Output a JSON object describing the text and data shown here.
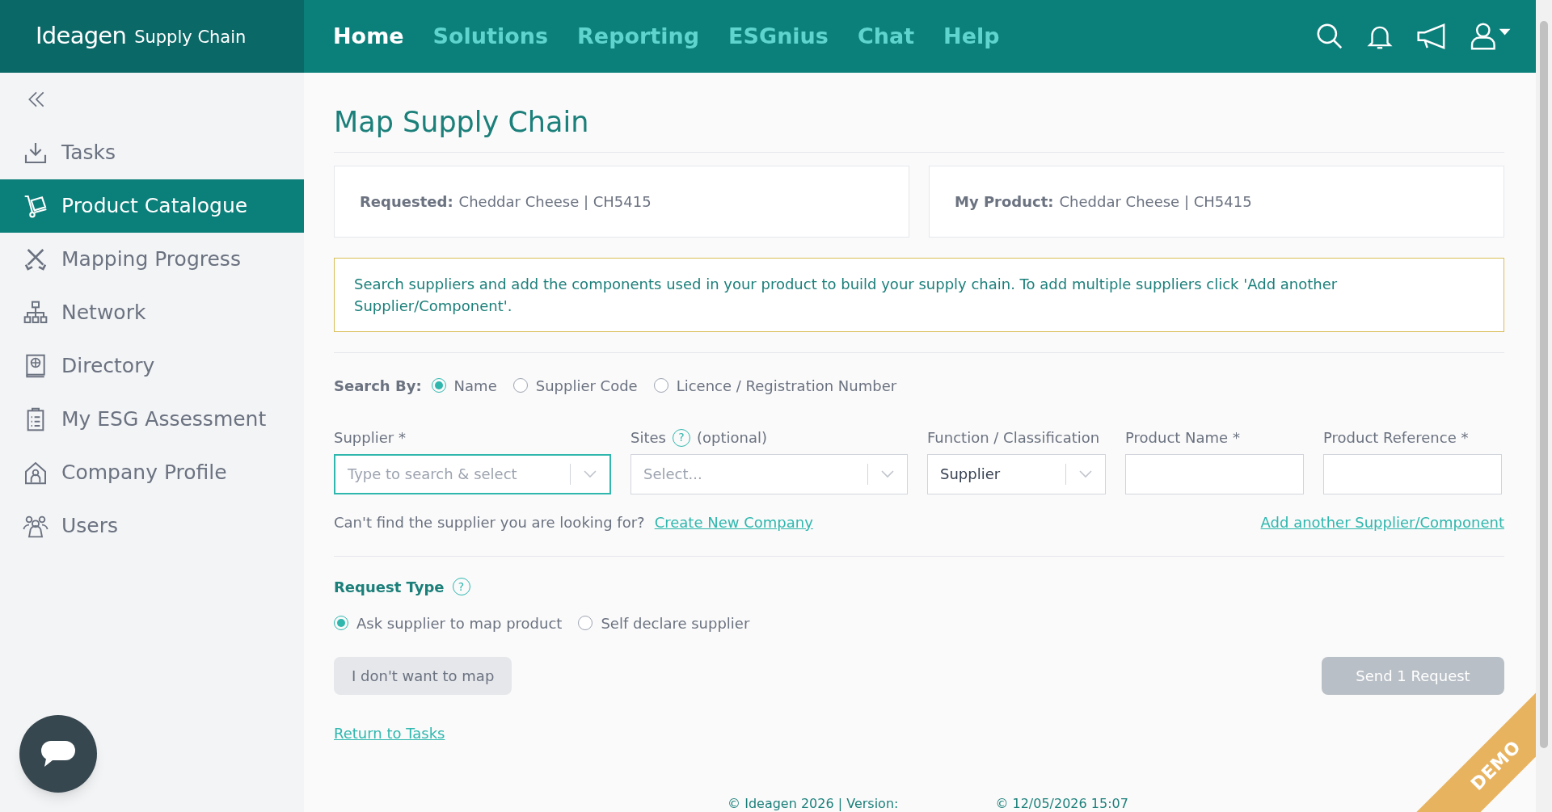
{
  "header": {
    "logo": {
      "brand": "Ideagen",
      "product": "Supply Chain"
    },
    "nav": [
      {
        "label": "Home",
        "selected": true
      },
      {
        "label": "Solutions",
        "selected": false
      },
      {
        "label": "Reporting",
        "selected": false
      },
      {
        "label": "ESGnius",
        "selected": false
      },
      {
        "label": "Chat",
        "selected": false
      },
      {
        "label": "Help",
        "selected": false
      }
    ]
  },
  "sidebar": {
    "items": [
      {
        "label": "Tasks",
        "selected": false
      },
      {
        "label": "Product Catalogue",
        "selected": true
      },
      {
        "label": "Mapping Progress",
        "selected": false
      },
      {
        "label": "Network",
        "selected": false
      },
      {
        "label": "Directory",
        "selected": false
      },
      {
        "label": "My ESG Assessment",
        "selected": false
      },
      {
        "label": "Company Profile",
        "selected": false
      },
      {
        "label": "Users",
        "selected": false
      }
    ]
  },
  "page": {
    "title": "Map Supply Chain",
    "cards": [
      {
        "label": "Requested:",
        "value": "Cheddar Cheese | CH5415"
      },
      {
        "label": "My Product:",
        "value": "Cheddar Cheese | CH5415"
      }
    ],
    "info": "Search suppliers and add the components used in your product to build your supply chain. To add multiple suppliers click 'Add another Supplier/Component'.",
    "search_by": {
      "label": "Search By:",
      "options": [
        {
          "label": "Name",
          "selected": true
        },
        {
          "label": "Supplier Code",
          "selected": false
        },
        {
          "label": "Licence / Registration Number",
          "selected": false
        }
      ]
    },
    "fields": [
      {
        "kind": "select",
        "label": "Supplier *",
        "placeholder": "Type to search & select",
        "focused": true
      },
      {
        "kind": "select",
        "label": "Sites",
        "help": "?",
        "suffix": "(optional)",
        "placeholder": "Select...",
        "focused": false
      },
      {
        "kind": "select",
        "label": "Function / Classification",
        "value": "Supplier",
        "focused": false
      },
      {
        "kind": "text",
        "label": "Product Name *",
        "focused": false
      },
      {
        "kind": "text",
        "label": "Product Reference *",
        "focused": false
      }
    ],
    "not_found": "Can't find the supplier you are looking for?",
    "create_link": "Create New Company",
    "add_link": "Add another Supplier/Component",
    "request_type": {
      "label": "Request Type",
      "help": "?",
      "options": [
        {
          "label": "Ask supplier to map product",
          "selected": true
        },
        {
          "label": "Self declare supplier",
          "selected": false
        }
      ]
    },
    "buttons": [
      {
        "label": "I don't want to map",
        "disabled": false
      },
      {
        "label": "Send 1 Request",
        "disabled": true
      }
    ],
    "return_link": "Return to Tasks",
    "footer": [
      "© Ideagen 2026 | Version:",
      "© 12/05/2026 15:07"
    ],
    "ribbon": "DEMO"
  }
}
